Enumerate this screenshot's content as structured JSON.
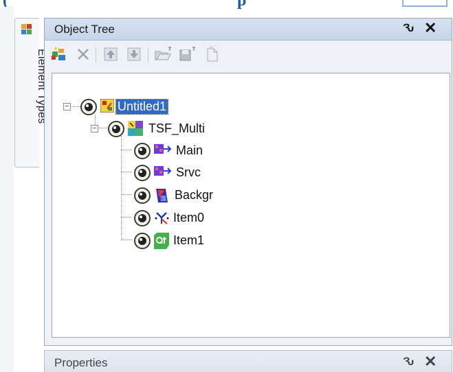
{
  "panel": {
    "title": "Object Tree"
  },
  "side_tab": {
    "label": "Element Types"
  },
  "pane_buttons": {
    "pin": "Ԅ",
    "close": "✕"
  },
  "toolbar": {
    "items": [
      "add-object",
      "delete",
      "move-up",
      "move-down",
      "open-folder",
      "save",
      "new-document"
    ]
  },
  "tree": {
    "root": {
      "label": "Untitled1",
      "selected": true
    },
    "group": {
      "label": "TSF_Multi"
    },
    "children": [
      {
        "label": "Main"
      },
      {
        "label": "Srvc"
      },
      {
        "label": "Backgr"
      },
      {
        "label": "Item0"
      },
      {
        "label": "Item1"
      }
    ]
  },
  "properties_panel": {
    "title": "Properties"
  },
  "colors": {
    "selection": "#3169c6",
    "title_bar": "#c7d5e9",
    "panel_bg": "#eef1f6"
  }
}
